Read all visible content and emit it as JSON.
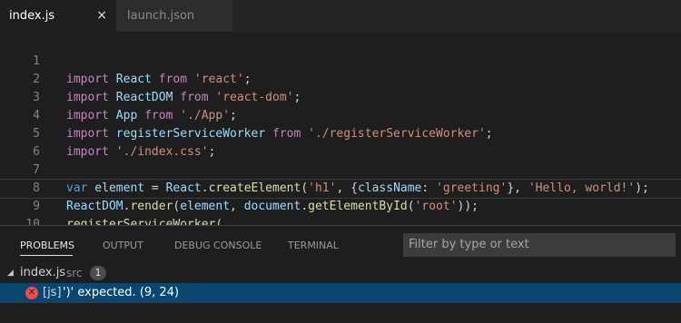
{
  "tabs": [
    {
      "label": "index.js",
      "active": true,
      "close": "×"
    },
    {
      "label": "launch.json",
      "active": false
    }
  ],
  "editor": {
    "line_numbers": [
      "1",
      "2",
      "3",
      "4",
      "5",
      "6",
      "7",
      "8",
      "9",
      "10"
    ],
    "lines": [
      {
        "tokens": [
          "import",
          " React ",
          "from",
          " 'react'",
          ";"
        ]
      },
      {
        "tokens": [
          "import",
          " ReactDOM ",
          "from",
          " 'react-dom'",
          ";"
        ]
      },
      {
        "tokens": [
          "import",
          " App ",
          "from",
          " './App'",
          ";"
        ]
      },
      {
        "tokens": [
          "import",
          " registerServiceWorker ",
          "from",
          " './registerServiceWorker'",
          ";"
        ]
      },
      {
        "tokens": [
          "import",
          " './index.css'",
          ";"
        ]
      },
      {
        "tokens": []
      },
      {
        "tokens": [
          "var",
          " element",
          " = ",
          "React",
          ".",
          "createElement",
          "(",
          "'h1'",
          ", {",
          "className",
          ": ",
          "'greeting'",
          "}, ",
          "'Hello, world!'",
          ");"
        ]
      },
      {
        "tokens": [
          "ReactDOM",
          ".",
          "render",
          "(",
          "element",
          ", ",
          "document",
          ".",
          "getElementById",
          "(",
          "'root'",
          "));"
        ]
      },
      {
        "tokens": [
          "registerServiceWorker",
          "("
        ]
      },
      {
        "tokens": []
      }
    ]
  },
  "panel": {
    "tabs": [
      "PROBLEMS",
      "OUTPUT",
      "DEBUG CONSOLE",
      "TERMINAL"
    ],
    "filter_placeholder": "Filter by type or text",
    "file": {
      "name": "index.js",
      "dir": "src",
      "count": "1"
    },
    "error": {
      "source": "[js]",
      "message": "')' expected. (9, 24)"
    }
  },
  "colors": {
    "keyword": "#c586c0",
    "identifier": "#9cdcfe",
    "string": "#ce9178",
    "function": "#dcdcaa",
    "var_keyword": "#569cd6",
    "selection": "#094771",
    "error": "#f14c4c"
  },
  "icons": {
    "close": "close-icon",
    "collapse": "chevron-down-icon",
    "error": "error-icon"
  }
}
